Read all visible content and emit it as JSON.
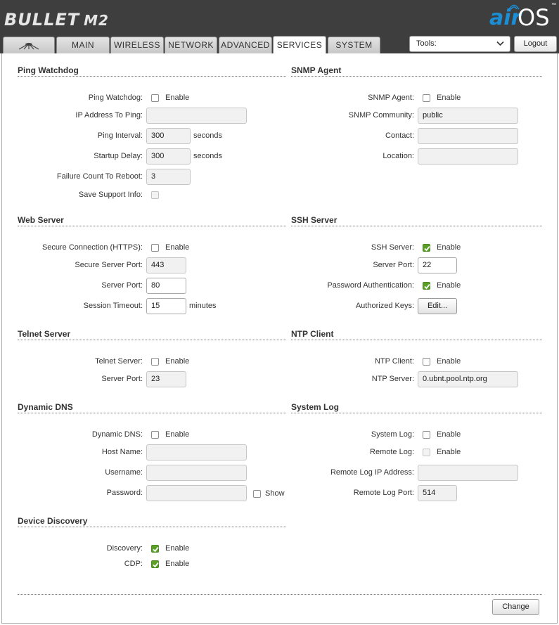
{
  "header": {
    "device_name": "BULLET",
    "device_model": "M2",
    "brand_air": "air",
    "brand_os": "OS",
    "brand_tm": "™"
  },
  "tabs": [
    {
      "label": "",
      "icon": "ubnt-logo-icon"
    },
    {
      "label": "MAIN"
    },
    {
      "label": "WIRELESS"
    },
    {
      "label": "NETWORK"
    },
    {
      "label": "ADVANCED"
    },
    {
      "label": "SERVICES",
      "active": true
    },
    {
      "label": "SYSTEM"
    }
  ],
  "tools": {
    "selected": "Tools:"
  },
  "logout_label": "Logout",
  "ping": {
    "title": "Ping Watchdog",
    "enable_label": "Ping Watchdog:",
    "enable_text": "Enable",
    "ip_label": "IP Address To Ping:",
    "ip_value": "",
    "interval_label": "Ping Interval:",
    "interval_value": "300",
    "interval_unit": "seconds",
    "delay_label": "Startup Delay:",
    "delay_value": "300",
    "delay_unit": "seconds",
    "failure_label": "Failure Count To Reboot:",
    "failure_value": "3",
    "support_label": "Save Support Info:"
  },
  "snmp": {
    "title": "SNMP Agent",
    "agent_label": "SNMP Agent:",
    "enable_text": "Enable",
    "community_label": "SNMP Community:",
    "community_value": "public",
    "contact_label": "Contact:",
    "contact_value": "",
    "location_label": "Location:",
    "location_value": ""
  },
  "web": {
    "title": "Web Server",
    "https_label": "Secure Connection (HTTPS):",
    "enable_text": "Enable",
    "secure_port_label": "Secure Server Port:",
    "secure_port_value": "443",
    "port_label": "Server Port:",
    "port_value": "80",
    "timeout_label": "Session Timeout:",
    "timeout_value": "15",
    "timeout_unit": "minutes"
  },
  "ssh": {
    "title": "SSH Server",
    "server_label": "SSH Server:",
    "enable_text": "Enable",
    "port_label": "Server Port:",
    "port_value": "22",
    "password_label": "Password Authentication:",
    "password_enable_text": "Enable",
    "keys_label": "Authorized Keys:",
    "edit_label": "Edit..."
  },
  "telnet": {
    "title": "Telnet Server",
    "server_label": "Telnet Server:",
    "enable_text": "Enable",
    "port_label": "Server Port:",
    "port_value": "23"
  },
  "ntp": {
    "title": "NTP Client",
    "client_label": "NTP Client:",
    "enable_text": "Enable",
    "server_label": "NTP Server:",
    "server_value": "0.ubnt.pool.ntp.org"
  },
  "ddns": {
    "title": "Dynamic DNS",
    "enable_label": "Dynamic DNS:",
    "enable_text": "Enable",
    "host_label": "Host Name:",
    "host_value": "",
    "user_label": "Username:",
    "user_value": "",
    "pass_label": "Password:",
    "pass_value": "",
    "show_text": "Show"
  },
  "syslog": {
    "title": "System Log",
    "log_label": "System Log:",
    "enable_text": "Enable",
    "remote_label": "Remote Log:",
    "remote_enable_text": "Enable",
    "remote_ip_label": "Remote Log IP Address:",
    "remote_ip_value": "",
    "remote_port_label": "Remote Log Port:",
    "remote_port_value": "514"
  },
  "discovery": {
    "title": "Device Discovery",
    "discovery_label": "Discovery:",
    "discovery_text": "Enable",
    "cdp_label": "CDP:",
    "cdp_text": "Enable"
  },
  "change_label": "Change"
}
